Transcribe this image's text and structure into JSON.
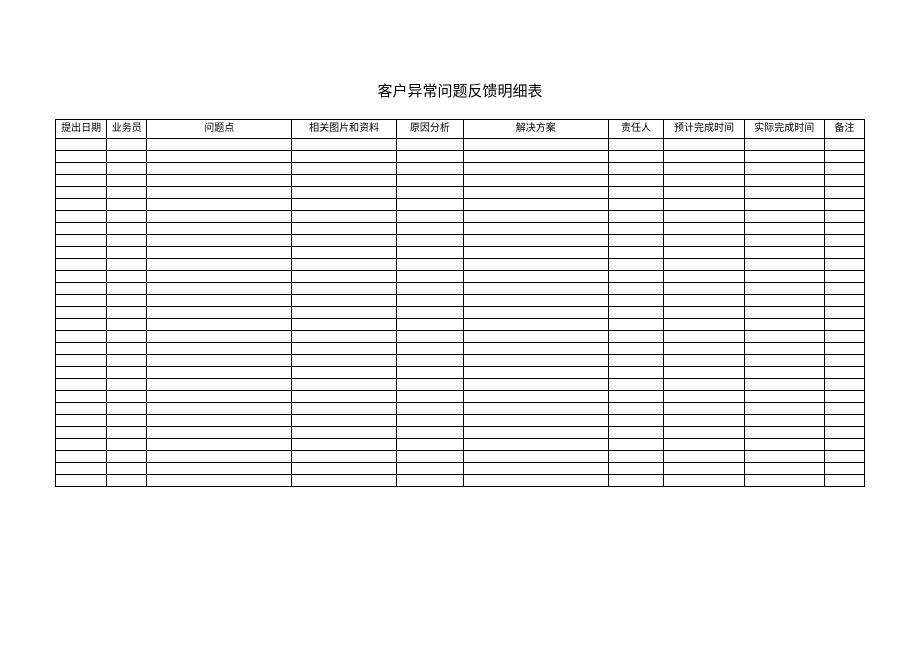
{
  "title": "客户异常问题反馈明细表",
  "columns": [
    "提出日期",
    "业务员",
    "问题点",
    "相关图片和资料",
    "原因分析",
    "解决方案",
    "责任人",
    "预计完成时间",
    "实际完成时间",
    "备注"
  ],
  "rowCount": 29
}
